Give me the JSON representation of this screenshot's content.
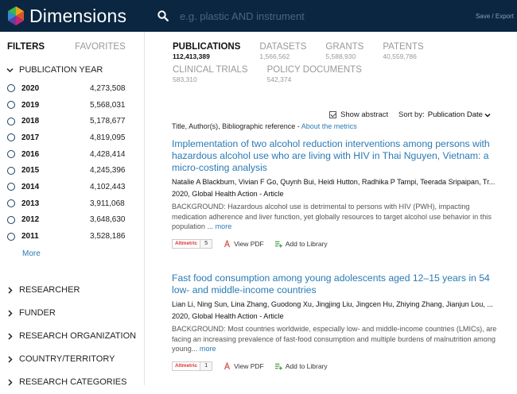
{
  "header": {
    "brand": "Dimensions",
    "search_placeholder": "e.g. plastic AND instrument",
    "save_export": "Save / Export",
    "colors": {
      "bar": "#0a2640",
      "link": "#2a7ab5"
    }
  },
  "sidebar": {
    "tabs": [
      "FILTERS",
      "FAVORITES"
    ],
    "publication_year": {
      "label": "PUBLICATION YEAR",
      "years": [
        {
          "year": "2020",
          "count": "4,273,508"
        },
        {
          "year": "2019",
          "count": "5,568,031"
        },
        {
          "year": "2018",
          "count": "5,178,677"
        },
        {
          "year": "2017",
          "count": "4,819,095"
        },
        {
          "year": "2016",
          "count": "4,428,414"
        },
        {
          "year": "2015",
          "count": "4,245,396"
        },
        {
          "year": "2014",
          "count": "4,102,443"
        },
        {
          "year": "2013",
          "count": "3,911,068"
        },
        {
          "year": "2012",
          "count": "3,648,630"
        },
        {
          "year": "2011",
          "count": "3,528,186"
        }
      ],
      "more": "More"
    },
    "sections": [
      "RESEARCHER",
      "FUNDER",
      "RESEARCH ORGANIZATION",
      "COUNTRY/TERRITORY",
      "RESEARCH CATEGORIES"
    ]
  },
  "types": [
    {
      "name": "PUBLICATIONS",
      "count": "112,413,389",
      "active": true
    },
    {
      "name": "DATASETS",
      "count": "1,566,562"
    },
    {
      "name": "GRANTS",
      "count": "5,588,930"
    },
    {
      "name": "PATENTS",
      "count": "40,559,786"
    },
    {
      "name": "CLINICAL TRIALS",
      "count": "583,310"
    },
    {
      "name": "POLICY DOCUMENTS",
      "count": "542,374"
    }
  ],
  "controls": {
    "show_abstract": "Show abstract",
    "sort_label": "Sort by:",
    "sort_value": "Publication Date"
  },
  "biblio": {
    "text": "Title, Author(s), Bibliographic reference - ",
    "link": "About the metrics"
  },
  "results": [
    {
      "title": "Implementation of two alcohol reduction interventions among persons with hazardous alcohol use who are living with HIV in Thai Nguyen, Vietnam: a micro-costing analysis",
      "authors": "Natalie A Blackburn, Vivian F Go, Quynh Bui, Heidi Hutton, Radhika P Tampi, Teerada Sripaipan, Tr...",
      "meta": "2020, Global Health Action - Article",
      "abstract": "BACKGROUND: Hazardous alcohol use is detrimental to persons with HIV (PWH), impacting medication adherence and liver function, yet globally resources to target alcohol use behavior in this population ... ",
      "more": "more",
      "altmetric_label": "Altmetric",
      "altmetric_score": "5",
      "view_pdf": "View PDF",
      "add_library": "Add to Library"
    },
    {
      "title": "Fast food consumption among young adolescents aged 12–15 years in 54 low- and middle-income countries",
      "authors": "Lian Li, Ning Sun, Lina Zhang, Guodong Xu, Jingjing Liu, Jingcen Hu, Zhiying Zhang, Jianjun Lou, ...",
      "meta": "2020, Global Health Action - Article",
      "abstract": "BACKGROUND: Most countries worldwide, especially low- and middle-income countries (LMICs), are facing an increasing prevalence of fast-food consumption and multiple burdens of malnutrition among young... ",
      "more": "more",
      "altmetric_label": "Altmetric",
      "altmetric_score": "1",
      "view_pdf": "View PDF",
      "add_library": "Add to Library"
    }
  ]
}
